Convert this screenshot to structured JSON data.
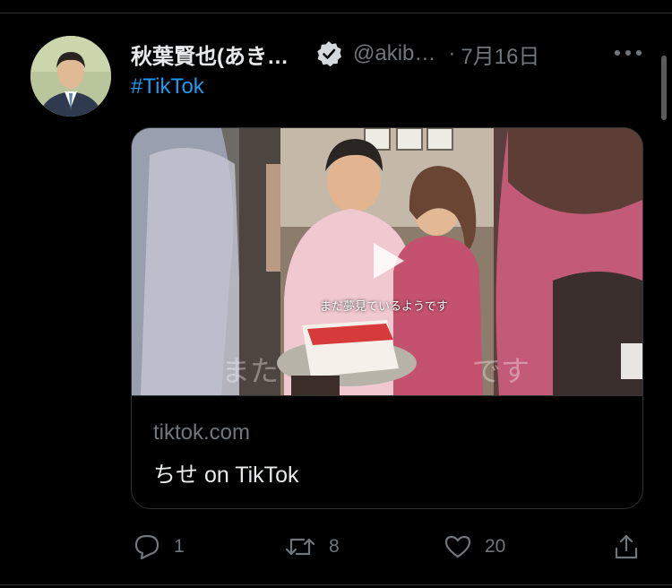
{
  "tweet": {
    "author_name": "秋葉賢也(あき…",
    "handle": "@akib…",
    "separator": "·",
    "date": "7月16日",
    "hashtag": "#TikTok",
    "verified": true
  },
  "card": {
    "domain": "tiktok.com",
    "title": "ちせ on TikTok",
    "video_caption": "まだ夢見ているようです",
    "ghost_left": "また",
    "ghost_right": "です"
  },
  "actions": {
    "reply_count": "1",
    "retweet_count": "8",
    "like_count": "20"
  },
  "icons": [
    "verified-badge-icon",
    "more-icon",
    "play-icon",
    "reply-icon",
    "retweet-icon",
    "like-icon",
    "share-icon"
  ],
  "colors": {
    "background": "#000000",
    "text": "#e7e9ea",
    "muted": "#71767b",
    "link": "#1d9bf0",
    "border": "#2f3336"
  }
}
